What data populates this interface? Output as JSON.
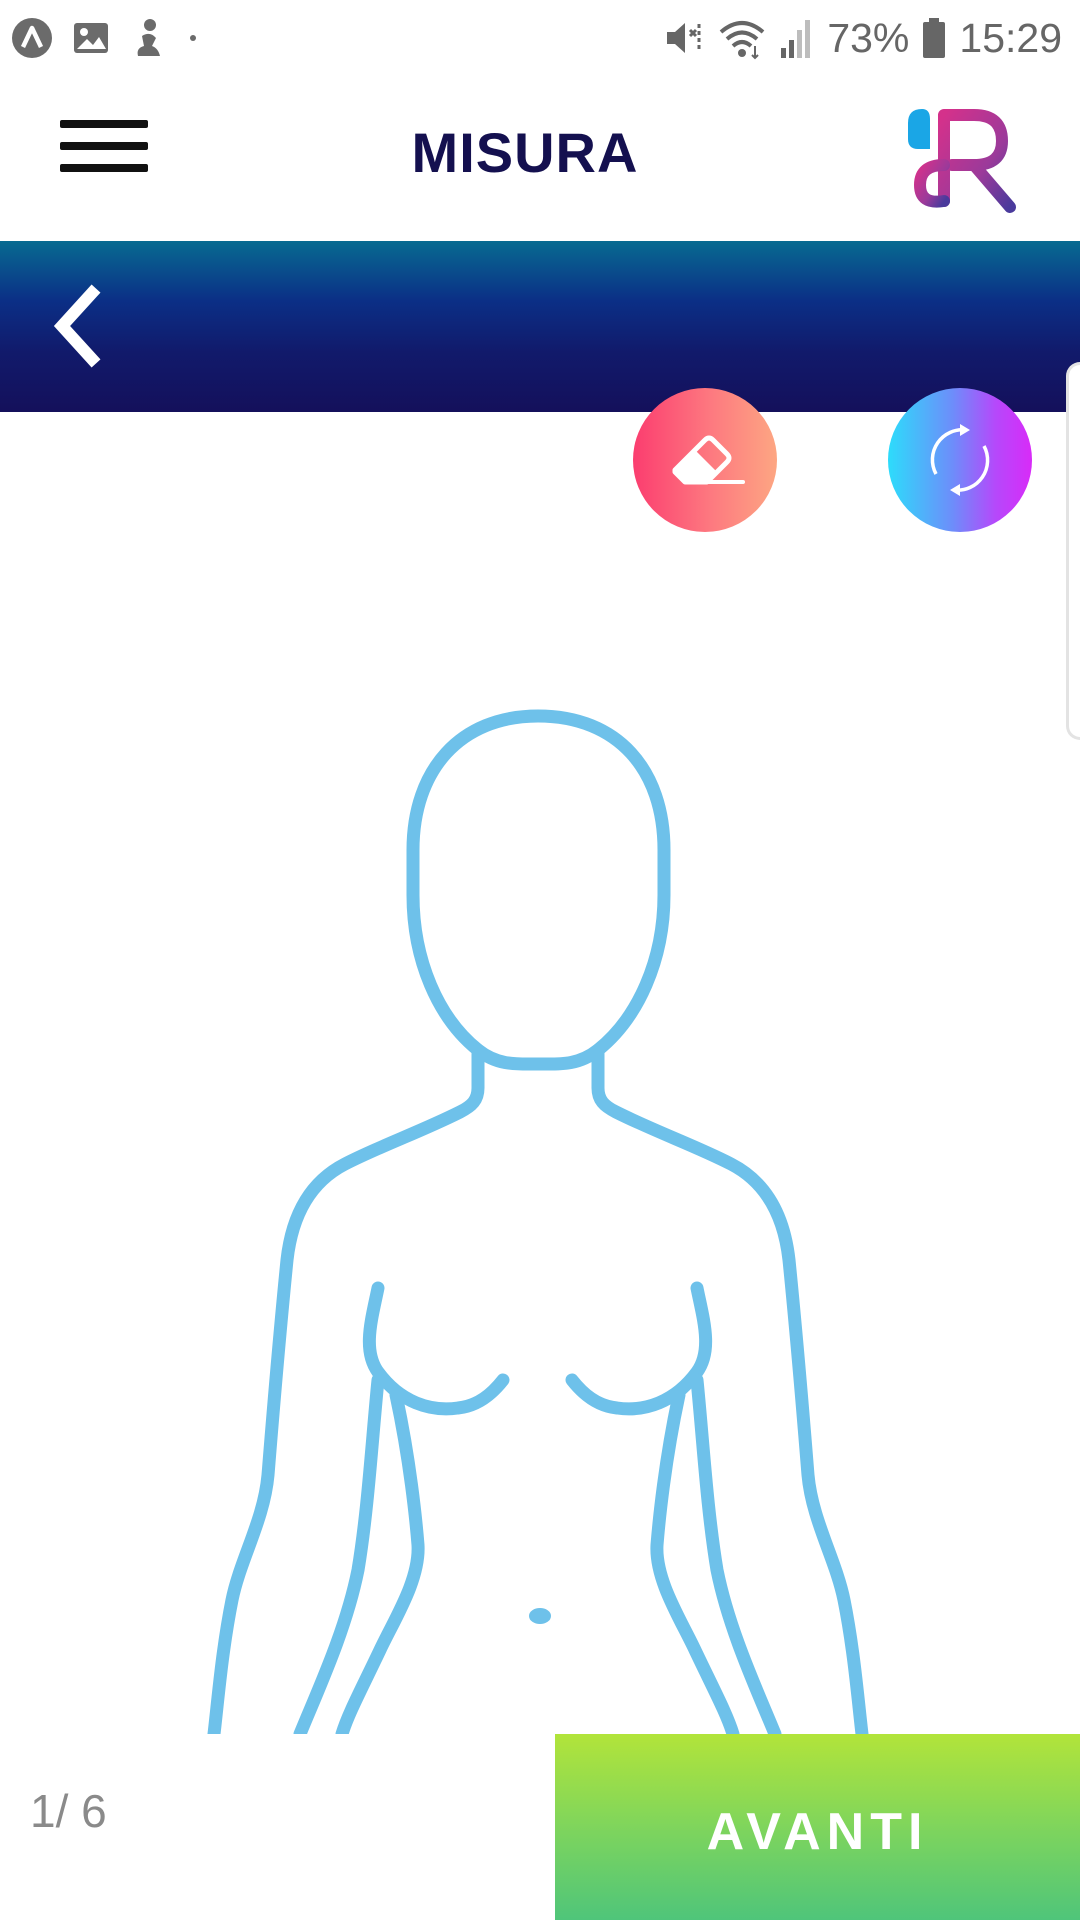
{
  "status_bar": {
    "battery_percent": "73%",
    "time": "15:29",
    "left_icons": [
      "app-notification-icon",
      "image-icon",
      "activity-icon",
      "dot-icon"
    ],
    "right_icons": [
      "mute-vibrate-icon",
      "wifi-icon",
      "signal-icon",
      "battery-icon"
    ]
  },
  "header": {
    "title": "MISURA",
    "menu_icon": "hamburger-menu-icon",
    "logo_icon": "brand-logo-r"
  },
  "nav": {
    "back_icon": "chevron-left-icon"
  },
  "actions": {
    "eraser_icon": "eraser-icon",
    "reset_icon": "refresh-icon"
  },
  "body": {
    "figure": "female-body-outline"
  },
  "footer": {
    "page_counter": "1/ 6",
    "next_label": "AVANTI"
  },
  "colors": {
    "title": "#14104f",
    "outline": "#6ec1ea",
    "nav_band_top": "#086b91",
    "nav_band_bottom": "#14105b",
    "next_button_top": "#b2e43a",
    "next_button_bottom": "#4fc57a",
    "eraser_left": "#fb3d6f",
    "eraser_right": "#fda682",
    "reset_left": "#2ddcfb",
    "reset_right": "#d82bf8"
  }
}
